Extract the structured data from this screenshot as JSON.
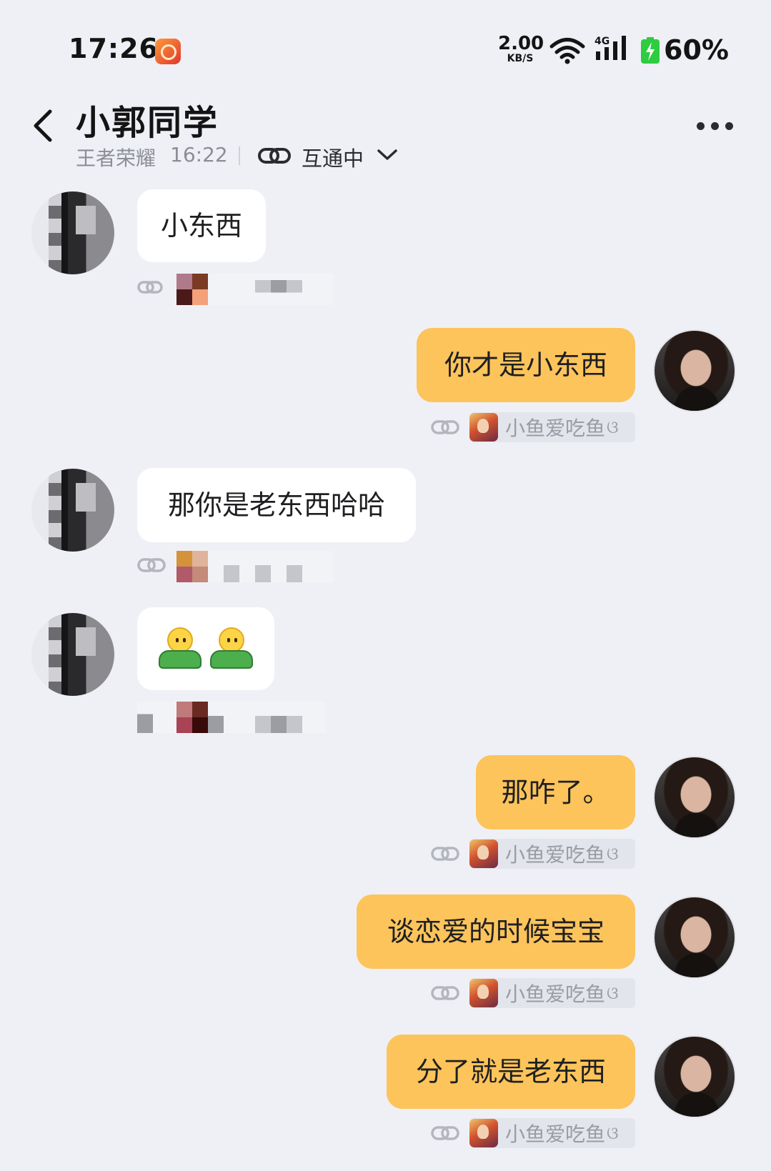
{
  "status_bar": {
    "time": "17:26",
    "net_speed_value": "2.00",
    "net_speed_unit": "KB/S",
    "cell_label": "4G",
    "battery": "60%",
    "battery_color": "#2ecc40"
  },
  "header": {
    "title": "小郭同学",
    "game": "王者荣耀",
    "time": "16:22",
    "mutual_label": "互通中"
  },
  "colors": {
    "background": "#eff0f5",
    "incoming_bubble": "#ffffff",
    "outgoing_bubble": "#fcc45a"
  },
  "messages": [
    {
      "side": "left",
      "text": "小东西"
    },
    {
      "side": "right",
      "text": "你才是小东西",
      "meta_name": "小鱼爱吃鱼"
    },
    {
      "side": "left",
      "text": "那你是老东西哈哈"
    },
    {
      "side": "left",
      "text": "",
      "emoji": [
        "standing-person-emoji",
        "standing-person-emoji"
      ]
    },
    {
      "side": "right",
      "text": "那咋了。",
      "meta_name": "小鱼爱吃鱼"
    },
    {
      "side": "right",
      "text": "谈恋爱的时候宝宝",
      "meta_name": "小鱼爱吃鱼"
    },
    {
      "side": "right",
      "text": "分了就是老东西",
      "meta_name": "小鱼爱吃鱼"
    }
  ]
}
